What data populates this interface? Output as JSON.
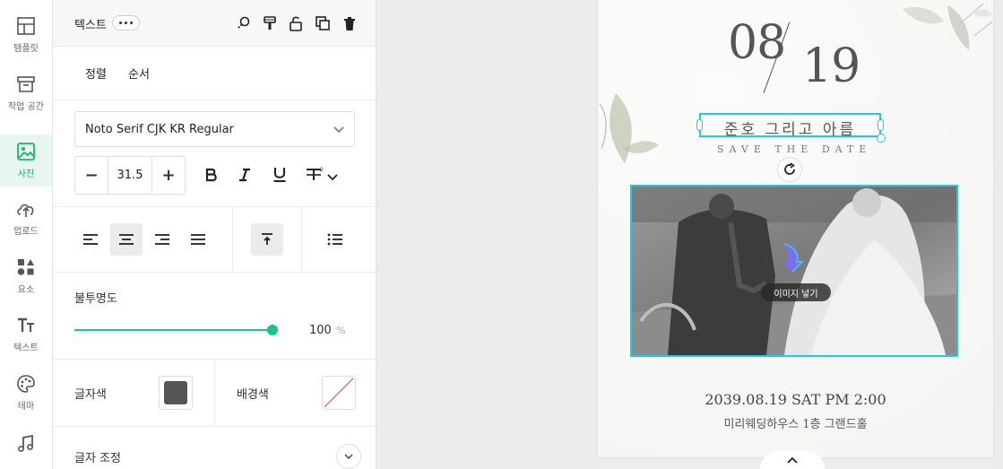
{
  "rail": {
    "items": [
      {
        "label": "템플릿",
        "icon": "layout-icon"
      },
      {
        "label": "작업 공간",
        "icon": "archive-icon"
      },
      {
        "label": "사진",
        "icon": "image-icon"
      },
      {
        "label": "업로드",
        "icon": "upload-cloud-icon"
      },
      {
        "label": "요소",
        "icon": "shapes-icon"
      },
      {
        "label": "텍스트",
        "icon": "text-icon"
      },
      {
        "label": "테마",
        "icon": "palette-icon"
      },
      {
        "label": "",
        "icon": "music-icon"
      }
    ],
    "active_index": 2
  },
  "panel": {
    "title": "텍스트",
    "toolbar_icons": [
      "find-replace-icon",
      "format-paint-icon",
      "unlock-icon",
      "duplicate-icon",
      "trash-icon"
    ],
    "tabs": {
      "align": "정렬",
      "order": "순서"
    },
    "font": {
      "family": "Noto Serif CJK KR Regular"
    },
    "size": {
      "value": "31.5",
      "minus": "−",
      "plus": "+"
    },
    "format_icons": [
      "bold-icon",
      "italic-icon",
      "underline-icon",
      "strikethrough-icon"
    ],
    "align_icons": [
      "align-left-icon",
      "align-center-icon",
      "align-right-icon",
      "align-justify-icon"
    ],
    "align_selected": "align-center-icon",
    "valign_icon": "align-top-icon",
    "list_icon": "list-icon",
    "opacity": {
      "label": "불투명도",
      "value": "100",
      "unit": "%",
      "level": 1.0
    },
    "text_color": {
      "label": "글자색",
      "color": "#555555"
    },
    "bg_color": {
      "label": "배경색",
      "color": "none"
    },
    "adjust": {
      "label": "글자 조정"
    },
    "accent_color": "#18c48f"
  },
  "canvas": {
    "month": "08",
    "day": "19",
    "names": "준호 그리고 아름",
    "save_the_date": "SAVE THE DATE",
    "insert_image": "이미지 넣기",
    "event_datetime": "2039.08.19 SAT PM 2:00",
    "venue": "미리웨딩하우스 1층 그랜드홀",
    "selection_color": "#22c9dd"
  }
}
